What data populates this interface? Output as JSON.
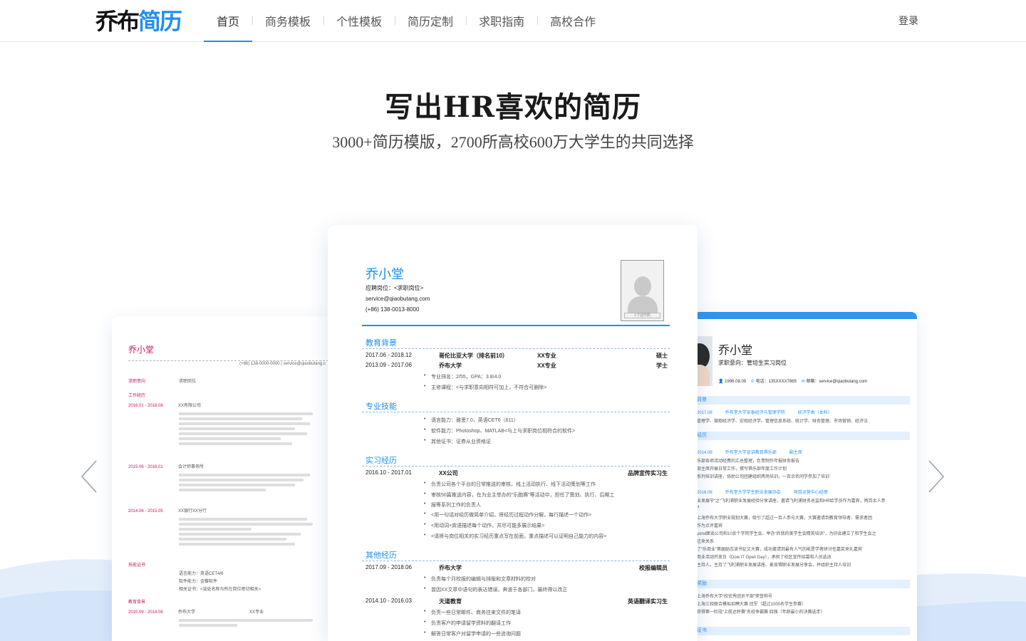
{
  "header": {
    "logo_part1": "乔布",
    "logo_part2": "简历",
    "nav": [
      {
        "label": "首页"
      },
      {
        "label": "商务模板"
      },
      {
        "label": "个性模板"
      },
      {
        "label": "简历定制"
      },
      {
        "label": "求职指南"
      },
      {
        "label": "高校合作"
      }
    ],
    "active_index": 0,
    "login_label": "登录"
  },
  "hero": {
    "title": "写出HR喜欢的简历",
    "subtitle": "3000+简历模版，2700所高校600万大学生的共同选择"
  },
  "colors": {
    "accent": "#1f8ef1",
    "left_accent": "#c2185b",
    "wave": "#dbe9fb"
  },
  "icons": {
    "prev": "chevron-left-icon",
    "next": "chevron-right-icon"
  },
  "resume_left": {
    "name": "乔小堂",
    "contact": "(+86) 138-0000-0000 | service@qiaobutang.c",
    "sections": [
      {
        "label": "求职意向",
        "value": "求职岗位"
      },
      {
        "label": "工作经历"
      },
      {
        "label": "技能证书"
      },
      {
        "label": "教育背景"
      }
    ],
    "entries": [
      {
        "date": "2016.01 - 2018.08",
        "org": "XX有限公司"
      },
      {
        "date": "2015.06 - 2016.01",
        "org": "会计师事务所"
      },
      {
        "date": "2014.06 - 2015.05",
        "org": "XX银行XX分行"
      },
      {
        "date": "2010.09 - 2014.06",
        "org": "乔布大学",
        "extra": "XX专业"
      }
    ],
    "skills": [
      "语言能力：英语CET4/6",
      "软件能力：金蝶软件",
      "相关证书：<该处名称与所在岗位密切相关>"
    ]
  },
  "resume_center": {
    "name": "乔小堂",
    "position": "应聘岗位：<求职岗位>",
    "email": "service@qiaobutang.com",
    "phone": "(+86) 138-0013-8000",
    "photo_caption": "1寸证件照",
    "sections": {
      "education": "教育背景",
      "skills": "专业技能",
      "internship": "实习经历",
      "other": "其他经历"
    },
    "education": [
      {
        "date": "2017.06 - 2018.12",
        "school": "哥伦比亚大学（排名前10）",
        "major": "XX专业",
        "degree": "硕士"
      },
      {
        "date": "2013.09 - 2017.06",
        "school": "乔布大学",
        "major": "XX专业",
        "degree": "学士"
      }
    ],
    "education_bullets": [
      "专业排名：2/55，GPA：3.8/4.0",
      "主修课程：<与求职意向相符可加上，不符合可删除>"
    ],
    "skill_bullets": [
      "语言能力：雅思7.0，英语CET6（611）",
      "软件能力：Photoshop、MATLAB<与上与求职岗位相符合的软件>",
      "其他证书：证券从业资格证"
    ],
    "internship": {
      "date": "2016.10 - 2017.01",
      "org": "XX公司",
      "role": "品牌宣传实习生"
    },
    "internship_bullets": [
      "负责公司各个平台的日常推送的审核、线上活动执行、线下活动策划等工作",
      "审核50篇推送内容，在为业主举办的“乐跑赛”等活动中，担任了策划、执行、后期工",
      "报等系列工作的负责人",
      "<用一句话对经历做简单介绍，将经历过程动作分解，每行描述一个动作>",
      "<用动词+宾语描述每个动作，并尽可能多展示结果>",
      "<请将与岗位相关的实习经历重点写在前面，重点描述可以证明自己能力的内容>"
    ],
    "other": [
      {
        "date": "2017.09 - 2018.06",
        "org": "乔布大学",
        "role": "校报编辑员"
      },
      {
        "date": "2014.10 - 2016.03",
        "org": "天道教育",
        "role": "英语翻译实习生"
      }
    ],
    "other_bullets_a": [
      "负责每个月校报的编辑与排版和文章材料的校对",
      "曾因XX文章中语句的表达错误，奔波于各部门，最终得以改正"
    ],
    "other_bullets_b": [
      "负责一些日常邮件、商务往来文件的笔译",
      "负责客户的申请留学资料的翻译工作",
      "解答日常客户对留学申请的一些咨询问题"
    ]
  },
  "resume_right": {
    "name": "乔小堂",
    "job": "求职意向：管培生实习岗位",
    "birth": "1996.08.08",
    "phone": "电话：135XXXX7865",
    "email": "邮箱：service@qiaobutang.com",
    "sections": [
      "背景",
      "经历",
      "奖励",
      "证书"
    ],
    "edu_row": "2017.06　　　乔布堂大学安泰经济与管理学院　　　经济学类（本科）",
    "edu_detail": "管理学、微观经济学、宏观经济学、管理信息系统、统计学、财务管理、市场营销、经济法",
    "exp1_head": "2014.06　　　乔布堂大学宣讲教育俱乐部　　　副主席",
    "exp1_lines": [
      "乐部各项活动经费的汇总整理，负责制作年报财务报告",
      "部主席开展日常工作，撰写俱乐部年度工作计划",
      "系列培训讲座，协助公司团建组织两场培训，一百余名同学参加了培训"
    ],
    "exp2_head": "2016.06　　　乔布堂大学学生职业发展协会　　　项目运营中心经理",
    "exp2_lines": [
      "业发展节“之“飞利浦职业发展经验分享讲座，邀请飞利浦财务总监和HR给学员作为嘉宾，两百余人参",
      "上海乔布大学职业规划大赛，吸引了超过一百人参与大赛，大赛邀请到教育领导者、需求者团",
      "作为点评嘉宾",
      "yond面谈公司和10余个学院学生会、举办“后我的美学生会精英培训”，为协会建立了和学生会之",
      "往来关系",
      "了“乐商业”第届励志读书征文大赛，成功邀请到最有人气的能是学者研讨任嘉奖来礼嘉宾",
      "商业活动开放日（Dow IT Open Day），承担了校区宣传招募和人员选派",
      "主持人，主持了飞利浦职业发展讲座、麦肯锡职业发展分享会，并组织主持人培训"
    ],
    "award_lines": [
      "上海乔布大学“校优秀团员干部”荣誉称号",
      "上海三校联合模拟招聘大赛 冠军（超过1000名学生参赛）",
      "获得第一阶段“上航达杯赛”名校争霸赛 四强（年龄最小的决赛选手）"
    ]
  }
}
